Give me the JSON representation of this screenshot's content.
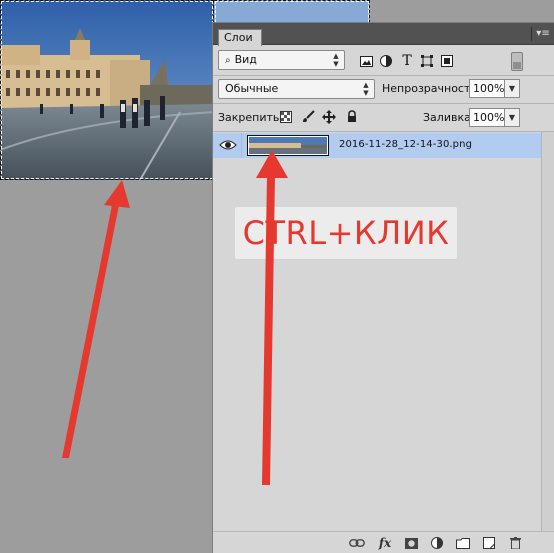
{
  "document": {
    "image_alt_colors": {
      "sky": "#3d6fb0",
      "building": "#d9bf95",
      "pavement": "#5e6a76"
    },
    "selection": "marquee"
  },
  "layers_panel": {
    "tab_label": "Слои",
    "menu_icon": "panel-menu-icon",
    "filter": {
      "kind_label": "Вид",
      "icons": [
        "image-filter-icon",
        "adjustment-filter-icon",
        "type-filter-icon",
        "shape-filter-icon",
        "smart-object-filter-icon"
      ],
      "type_glyph": "T"
    },
    "blend_mode": "Обычные",
    "opacity_label": "Непрозрачность:",
    "opacity_value": "100%",
    "lock_label": "Закрепить:",
    "lock_icons": [
      "lock-transparent-icon",
      "lock-paint-icon",
      "lock-move-icon",
      "lock-all-icon"
    ],
    "fill_label": "Заливка:",
    "fill_value": "100%",
    "layers": [
      {
        "name": "2016-11-28_12-14-30.png",
        "visible": true,
        "selected": true
      }
    ],
    "bottom_icons": [
      "link-layers-icon",
      "fx-icon",
      "add-mask-icon",
      "adjustment-layer-icon",
      "new-group-icon",
      "new-layer-icon",
      "delete-layer-icon"
    ],
    "fx_glyph": "fx"
  },
  "annotation": {
    "text": "CTRL+КЛИК",
    "color": "#e53930"
  },
  "colors": {
    "selected_row": "#b2cbf1",
    "panel_bg": "#d6d6d6",
    "canvas_bg": "#9d9d9d",
    "arrow": "#e53930"
  }
}
